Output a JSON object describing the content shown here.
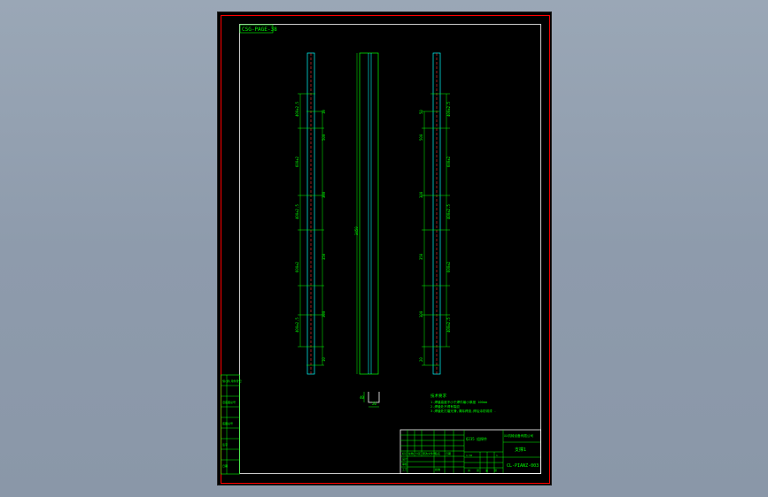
{
  "drawing": {
    "code_box": "CSG-PAGE-38",
    "center_dim": "3450",
    "dims_left": [
      "10",
      "500",
      "300",
      "350",
      "300",
      "10"
    ],
    "dims_left_inner": [
      "400±2.5",
      "600±2",
      "400±2.5",
      "600±2",
      "400±2.5"
    ],
    "dims_right": [
      "400±2.5",
      "600±2",
      "400±2.5",
      "600±2",
      "400±2.5"
    ],
    "dims_right_outer": [
      "50",
      "500",
      "300",
      "350",
      "300",
      "20"
    ],
    "section_dims": [
      "40",
      "20"
    ],
    "notes_title": "技术要求",
    "notes": [
      "1.焊缝高度不小于焊件最小厚度 100mm",
      "2.焊缝处不得有裂纹",
      "3.焊缝处打磨光滑,清除焊渣,焊后涂防锈漆 ."
    ]
  },
  "title_block": {
    "company": "XX机械设备有限公司",
    "part_name": "支撑1",
    "drawing_no": "CL-PIANZ-003",
    "material": "Q235 组焊件",
    "scale": "1:50",
    "qty": "1",
    "sheet_labels": [
      "共",
      "张",
      "第",
      "张"
    ],
    "row_labels": [
      "设计",
      "审核",
      "工艺",
      "批准"
    ],
    "header_labels": [
      "标记",
      "处数",
      "分区",
      "更改文件号",
      "签名",
      "日期"
    ]
  },
  "side_table": {
    "rows": [
      "借(通)用件登记",
      "",
      "旧底图总号",
      "",
      "底图总号",
      "",
      "签字",
      "",
      "日期"
    ]
  },
  "colors": {
    "frame": "#ff0000",
    "lines": "#00ff00",
    "part": "#00ffff",
    "centerline": "#ff3333",
    "text": "#00ff00"
  }
}
